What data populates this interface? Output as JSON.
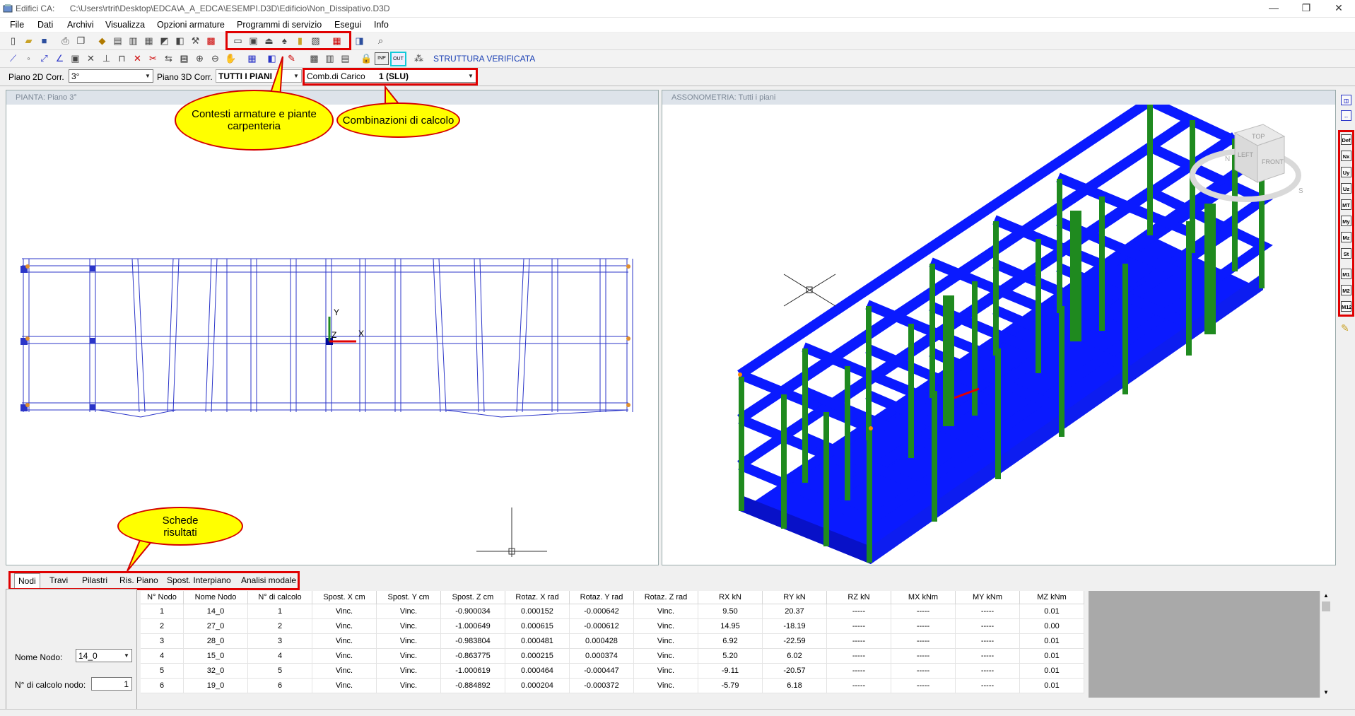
{
  "window": {
    "app_name": "Edifici CA:",
    "path": "C:\\Users\\rtrit\\Desktop\\EDCA\\A_A_EDCA\\ESEMPI.D3D\\Edificio\\Non_Dissipativo.D3D",
    "minimize": "—",
    "restore": "❐",
    "close": "✕"
  },
  "menu": [
    "File",
    "Dati",
    "Archivi",
    "Visualizza",
    "Opzioni armature",
    "Programmi di servizio",
    "Esegui",
    "Info"
  ],
  "toolbar2": {
    "status_text": "STRUTTURA VERIFICATA",
    "inp_label": "INP",
    "out_label": "OUT"
  },
  "combobar": {
    "piano2d_label": "Piano 2D Corr.",
    "piano2d_value": "3°",
    "piano3d_label": "Piano 3D Corr.",
    "piano3d_value": "TUTTI I PIANI",
    "comb_label": "Comb.di Carico",
    "comb_value": "1   (SLU)"
  },
  "panels": {
    "left_title": "PIANTA: Piano   3°",
    "right_title": "ASSONOMETRIA:  Tutti i piani"
  },
  "viewcube": {
    "top": "TOP",
    "left": "LEFT",
    "front": "FRONT",
    "n": "N",
    "s": "S"
  },
  "plan_axes": {
    "x": "X",
    "y": "Y",
    "z": "Z"
  },
  "callouts": {
    "armature": "Contesti armature e piante carpenteria",
    "combinazioni": "Combinazioni di calcolo",
    "schede": "Schede risultati"
  },
  "sidebar_buttons": [
    "Def",
    "Nx",
    "Uy",
    "Uz",
    "MT",
    "My",
    "Mz",
    "St",
    "M1",
    "M2",
    "M12"
  ],
  "tabs": [
    "Nodi",
    "Travi",
    "Pilastri",
    "Ris. Piano",
    "Spost. Interpiano",
    "Analisi modale"
  ],
  "left_form": {
    "nome_nodo_label": "Nome Nodo:",
    "nome_nodo_value": "14_0",
    "calcolo_label": "N° di calcolo nodo:",
    "calcolo_value": "1"
  },
  "table": {
    "headers": [
      "N° Nodo",
      "Nome Nodo",
      "N° di calcolo",
      "Spost. X cm",
      "Spost. Y  cm",
      "Spost. Z  cm",
      "Rotaz. X  rad",
      "Rotaz. Y  rad",
      "Rotaz. Z  rad",
      "RX   kN",
      "RY   kN",
      "RZ   kN",
      "MX   kNm",
      "MY   kNm",
      "MZ   kNm"
    ],
    "rows": [
      [
        "1",
        "14_0",
        "1",
        "Vinc.",
        "Vinc.",
        "-0.900034",
        "0.000152",
        "-0.000642",
        "Vinc.",
        "9.50",
        "20.37",
        "-----",
        "-----",
        "-----",
        "0.01"
      ],
      [
        "2",
        "27_0",
        "2",
        "Vinc.",
        "Vinc.",
        "-1.000649",
        "0.000615",
        "-0.000612",
        "Vinc.",
        "14.95",
        "-18.19",
        "-----",
        "-----",
        "-----",
        "0.00"
      ],
      [
        "3",
        "28_0",
        "3",
        "Vinc.",
        "Vinc.",
        "-0.983804",
        "0.000481",
        "0.000428",
        "Vinc.",
        "6.92",
        "-22.59",
        "-----",
        "-----",
        "-----",
        "0.01"
      ],
      [
        "4",
        "15_0",
        "4",
        "Vinc.",
        "Vinc.",
        "-0.863775",
        "0.000215",
        "0.000374",
        "Vinc.",
        "5.20",
        "6.02",
        "-----",
        "-----",
        "-----",
        "0.01"
      ],
      [
        "5",
        "32_0",
        "5",
        "Vinc.",
        "Vinc.",
        "-1.000619",
        "0.000464",
        "-0.000447",
        "Vinc.",
        "-9.11",
        "-20.57",
        "-----",
        "-----",
        "-----",
        "0.01"
      ],
      [
        "6",
        "19_0",
        "6",
        "Vinc.",
        "Vinc.",
        "-0.884892",
        "0.000204",
        "-0.000372",
        "Vinc.",
        "-5.79",
        "6.18",
        "-----",
        "-----",
        "-----",
        "0.01"
      ]
    ]
  },
  "colors": {
    "structure_blue": "#0a1aff",
    "column_green": "#1f8a1f",
    "highlight_red": "#e00000",
    "callout_yellow": "#ffff00",
    "plan_line": "#2b35c8"
  }
}
